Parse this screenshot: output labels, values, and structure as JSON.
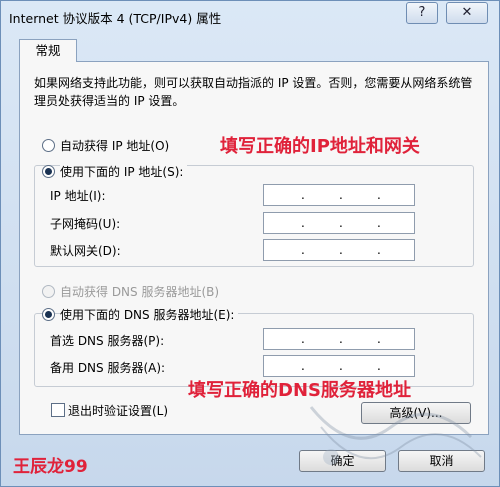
{
  "window": {
    "title": "Internet 协议版本 4 (TCP/IPv4) 属性",
    "help_symbol": "?",
    "close_symbol": "✕"
  },
  "tabs": [
    {
      "label": "常规"
    }
  ],
  "description": "如果网络支持此功能，则可以获取自动指派的 IP 设置。否则，您需要从网络系统管理员处获得适当的 IP 设置。",
  "ip_section": {
    "auto_option": "自动获得 IP 地址(O)",
    "manual_option": "使用下面的 IP 地址(S):",
    "selected": "manual",
    "fields": [
      {
        "label": "IP 地址(I):",
        "value": ". . ."
      },
      {
        "label": "子网掩码(U):",
        "value": ". . ."
      },
      {
        "label": "默认网关(D):",
        "value": ". . ."
      }
    ]
  },
  "dns_section": {
    "auto_option": "自动获得 DNS 服务器地址(B)",
    "manual_option": "使用下面的 DNS 服务器地址(E):",
    "selected": "manual",
    "fields": [
      {
        "label": "首选 DNS 服务器(P):",
        "value": ". . ."
      },
      {
        "label": "备用 DNS 服务器(A):",
        "value": ". . ."
      }
    ]
  },
  "validate_checkbox": {
    "label": "退出时验证设置(L)",
    "checked": false
  },
  "buttons": {
    "advanced": "高级(V)...",
    "ok": "确定",
    "cancel": "取消"
  },
  "annotations": {
    "ip_note": "填写正确的IP地址和网关",
    "dns_note": "填写正确的DNS服务器地址",
    "author": "王辰龙99"
  },
  "colors": {
    "annotation": "#e0223a",
    "window_frame": "#c7d8ec",
    "panel": "#f7f7f7"
  },
  "icons": {
    "help": "help-icon",
    "close": "close-icon"
  }
}
